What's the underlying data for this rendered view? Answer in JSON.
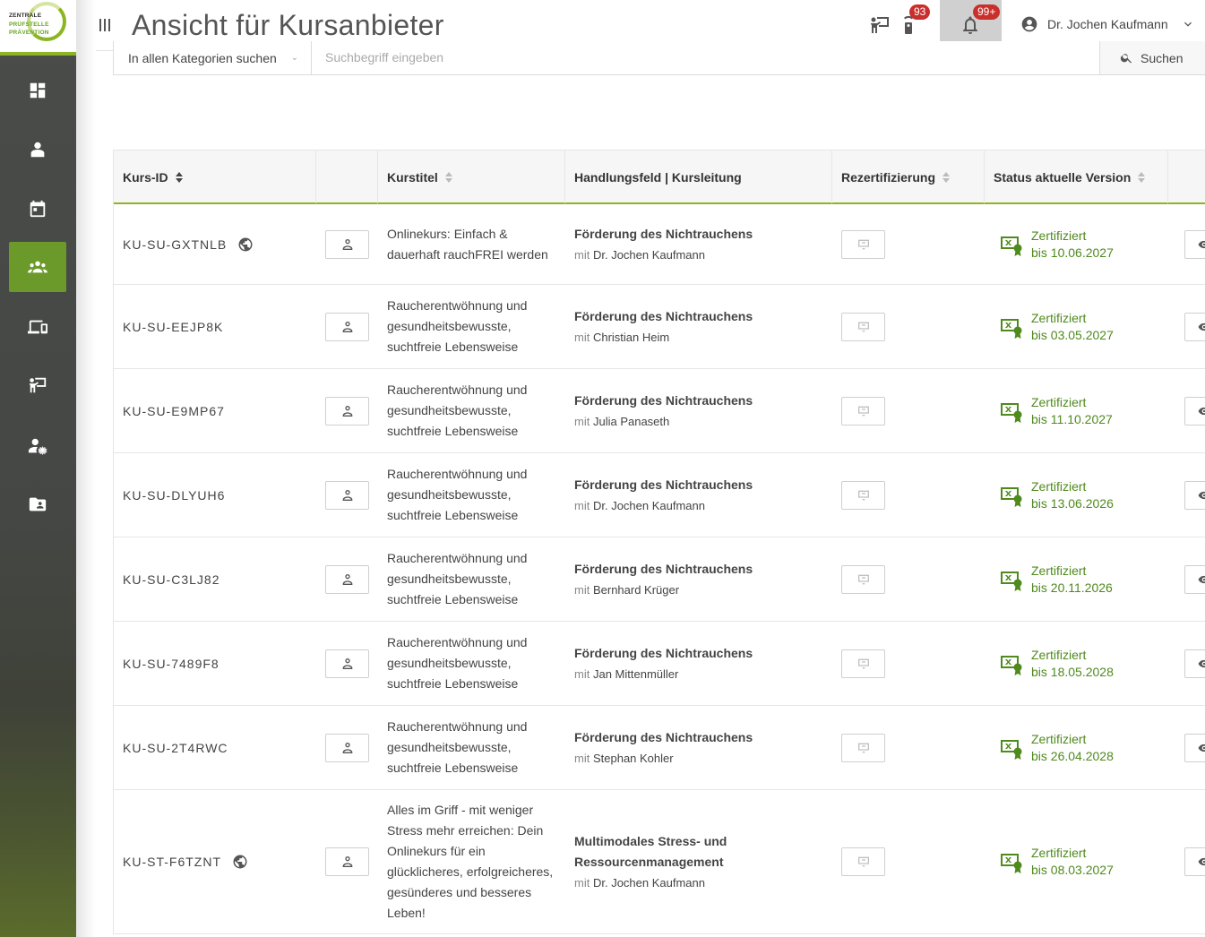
{
  "logo": {
    "line1": "ZENTRALE",
    "line2": "PRÜFSTELLE",
    "line3": "PRÄVENTION"
  },
  "header": {
    "title": "Ansicht für Kursanbieter",
    "badge_courses": "93",
    "badge_notifications": "99+",
    "user_name": "Dr. Jochen Kaufmann"
  },
  "sidebar": {
    "items": [
      {
        "icon": "dashboard-icon"
      },
      {
        "icon": "provider-icon"
      },
      {
        "icon": "calendar-icon"
      },
      {
        "icon": "group-icon",
        "active": true
      },
      {
        "icon": "devices-icon"
      },
      {
        "icon": "presenter-icon"
      },
      {
        "icon": "user-settings-icon"
      },
      {
        "icon": "folder-user-icon"
      }
    ]
  },
  "search": {
    "category": "In allen Kategorien suchen",
    "placeholder": "Suchbegriff eingeben",
    "button": "Suchen"
  },
  "table": {
    "headers": {
      "id": "Kurs-ID",
      "title": "Kurstitel",
      "field": "Handlungsfeld | Kursleitung",
      "rezert": "Rezertifizierung",
      "status": "Status aktuelle Version"
    },
    "lead_prefix": "mit",
    "rows": [
      {
        "id": "KU-SU-GXTNLB",
        "online": true,
        "title": "Onlinekurs: Einfach & dauerhaft rauchFREI werden",
        "field": "Förderung des Nichtrauchens",
        "leader": "Dr. Jochen Kaufmann",
        "status": "Zertifiziert",
        "until": "bis 10.06.2027"
      },
      {
        "id": "KU-SU-EEJP8K",
        "online": false,
        "title": "Raucherentwöhnung und gesundheitsbewusste, suchtfreie Lebensweise",
        "field": "Förderung des Nichtrauchens",
        "leader": "Christian Heim",
        "status": "Zertifiziert",
        "until": "bis 03.05.2027"
      },
      {
        "id": "KU-SU-E9MP67",
        "online": false,
        "title": "Raucherentwöhnung und gesundheitsbewusste, suchtfreie Lebensweise",
        "field": "Förderung des Nichtrauchens",
        "leader": "Julia Panaseth",
        "status": "Zertifiziert",
        "until": "bis 11.10.2027"
      },
      {
        "id": "KU-SU-DLYUH6",
        "online": false,
        "title": "Raucherentwöhnung und gesundheitsbewusste, suchtfreie Lebensweise",
        "field": "Förderung des Nichtrauchens",
        "leader": "Dr. Jochen Kaufmann",
        "status": "Zertifiziert",
        "until": "bis 13.06.2026"
      },
      {
        "id": "KU-SU-C3LJ82",
        "online": false,
        "title": "Raucherentwöhnung und gesundheitsbewusste, suchtfreie Lebensweise",
        "field": "Förderung des Nichtrauchens",
        "leader": "Bernhard Krüger",
        "status": "Zertifiziert",
        "until": "bis 20.11.2026"
      },
      {
        "id": "KU-SU-7489F8",
        "online": false,
        "title": "Raucherentwöhnung und gesundheitsbewusste, suchtfreie Lebensweise",
        "field": "Förderung des Nichtrauchens",
        "leader": "Jan Mittenmüller",
        "status": "Zertifiziert",
        "until": "bis 18.05.2028"
      },
      {
        "id": "KU-SU-2T4RWC",
        "online": false,
        "title": "Raucherentwöhnung und gesundheitsbewusste, suchtfreie Lebensweise",
        "field": "Förderung des Nichtrauchens",
        "leader": "Stephan Kohler",
        "status": "Zertifiziert",
        "until": "bis 26.04.2028"
      },
      {
        "id": "KU-ST-F6TZNT",
        "online": true,
        "title": "Alles im Griff - mit weniger Stress mehr erreichen: Dein Onlinekurs für ein glücklicheres, erfolgreicheres, gesünderes und besseres Leben!",
        "field": "Multimodales Stress- und Ressourcenmanagement",
        "leader": "Dr. Jochen Kaufmann",
        "status": "Zertifiziert",
        "until": "bis 08.03.2027"
      }
    ]
  }
}
